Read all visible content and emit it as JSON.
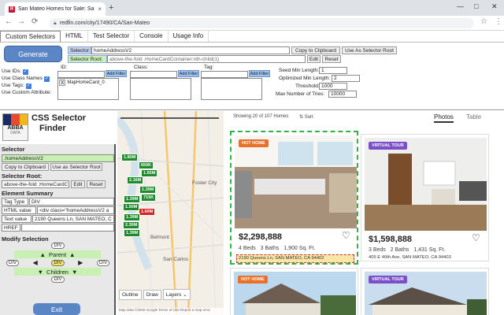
{
  "browser": {
    "tab_title": "San Mateo Homes for Sale: San",
    "url": "redfin.com/city/17490/CA/San-Mateo",
    "tab_close": "×",
    "new_tab": "+",
    "win_min": "—",
    "win_max": "□",
    "win_close": "✕",
    "back": "←",
    "forward": "→",
    "reload": "⟳",
    "star": "☆",
    "menu": "⋮"
  },
  "extension": {
    "tabs": [
      "Custom Selectors",
      "HTML",
      "Test Selector",
      "Console",
      "Usage Info"
    ],
    "generate_label": "Generate",
    "selector_label": "Selector:",
    "selector_value": "homeAddressV2",
    "copy_label": "Copy to Clipboard",
    "use_root_label": "Use As Selector Root",
    "root_label": "Selector Root:",
    "root_value": "above-the-fold .HomeCardContainer:nth-child(1)",
    "edit_label": "Edit",
    "reset_label": "Reset",
    "use_ids": "Use IDs:",
    "use_class_names": "Use Class Names",
    "use_tags": "Use Tags:",
    "use_custom_attr": "Use Custom Attribute:",
    "id_label": "ID:",
    "class_label": "Class:",
    "tag_label": "Tag:",
    "add_filter": "Add Filter",
    "id_filter_item": "MapHomeCard_0",
    "seed_label": "Seed Min Length:",
    "seed_value": "1",
    "opt_label": "Optimized Min Length:",
    "opt_value": "2",
    "threshold_label": "Threshold:",
    "threshold_value": "1000",
    "max_tries_label": "Max Number of Tries:",
    "max_tries_value": "10000"
  },
  "finder": {
    "logo_text": "ABBA",
    "logo_sub": "DATA",
    "title_line1": "CSS Selector",
    "title_line2": "Finder",
    "selector_heading": "Selector",
    "selector_value": ".homeAddressV2",
    "copy_label": "Copy to Clipboard",
    "use_root_label": "Use as Selector Root",
    "root_heading": "Selector Root:",
    "root_value": "above-the-fold .HomeCardC",
    "edit_label": "Edit",
    "reset_label": "Reset",
    "summary_heading": "Element Summary",
    "tag_type_label": "Tag Type",
    "tag_type_value": "DIV",
    "html_label": "HTML value",
    "html_value": "<div class=\"homeAddressV2 a",
    "text_label": "Text value",
    "text_value": "2190 Queens Ln, SAN MATEO, C",
    "href_label": "HREF",
    "href_value": "",
    "modify_heading": "Modify Selection",
    "parent_label": "Parent",
    "children_label": "Children",
    "div_tag": "DIV",
    "exit_label": "Exit"
  },
  "map": {
    "labels": [
      "Foster City",
      "Belmont",
      "San Carlos"
    ],
    "prices": [
      "1.80M",
      "650K",
      "1.65M",
      "2.16M",
      "1.39M",
      "715K",
      "1.39M",
      "1.50M",
      "1.60M",
      "1.39M",
      "2.30M",
      "1.39M"
    ],
    "outline": "Outline",
    "draw": "Draw",
    "layers": "Layers",
    "footer": "Map data ©2020 Google   Terms of Use   Report a map error"
  },
  "listings": {
    "showing": "Showing 20 of 107 Homes",
    "sort": "Sort",
    "view_tabs": [
      "Photos",
      "Table"
    ],
    "cards": [
      {
        "badge": "HOT HOME",
        "price": "$2,298,888",
        "beds": "4 Beds",
        "baths": "3 Baths",
        "sqft": "1,900 Sq. Ft.",
        "address": "2190 Queens Ln, SAN MATEO, CA 94402"
      },
      {
        "badge": "VIRTUAL TOUR",
        "price": "$1,598,888",
        "beds": "3 Beds",
        "baths": "2 Baths",
        "sqft": "1,431 Sq. Ft.",
        "address": "405 E 40th Ave, SAN MATEO, CA 94403"
      },
      {
        "badge": "HOT HOME"
      },
      {
        "badge": "VIRTUAL TOUR"
      }
    ],
    "heart": "♡"
  },
  "colors": {
    "hot_home": "#e8702a",
    "virtual_tour": "#7b4fc9",
    "highlight": "#2db34a",
    "generate": "#5a86c5"
  }
}
